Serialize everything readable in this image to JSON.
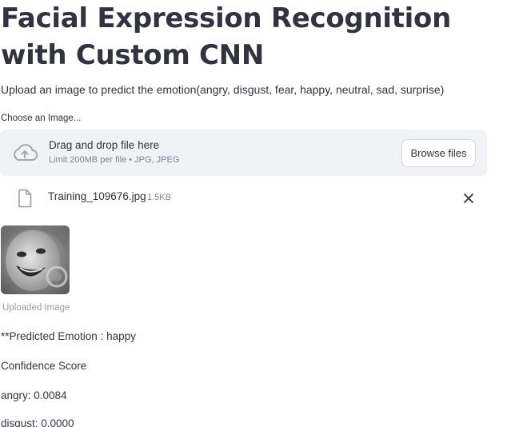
{
  "title": "Facial Expression Recognition with Custom CNN",
  "subtitle": "Upload an image to predict the emotion(angry, disgust, fear, happy, neutral, sad, surprise)",
  "uploader": {
    "label": "Choose an Image...",
    "drop_title": "Drag and drop file here",
    "drop_limit": "Limit 200MB per file • JPG, JPEG",
    "browse_label": "Browse files",
    "icons": {
      "upload": "cloud-upload-icon",
      "file": "file-icon",
      "remove": "close-icon"
    }
  },
  "file": {
    "name": "Training_109676.jpg",
    "size": "1.5KB"
  },
  "image": {
    "caption": "Uploaded Image"
  },
  "results": {
    "predicted": "**Predicted Emotion : happy",
    "confidence_heading": "Confidence Score",
    "scores": [
      "angry: 0.0084",
      "disgust: 0.0000"
    ]
  },
  "colors": {
    "text": "#31333f",
    "muted": "#808495",
    "dropzone_bg": "#f0f2f6",
    "button_border": "#d6d6d9"
  }
}
